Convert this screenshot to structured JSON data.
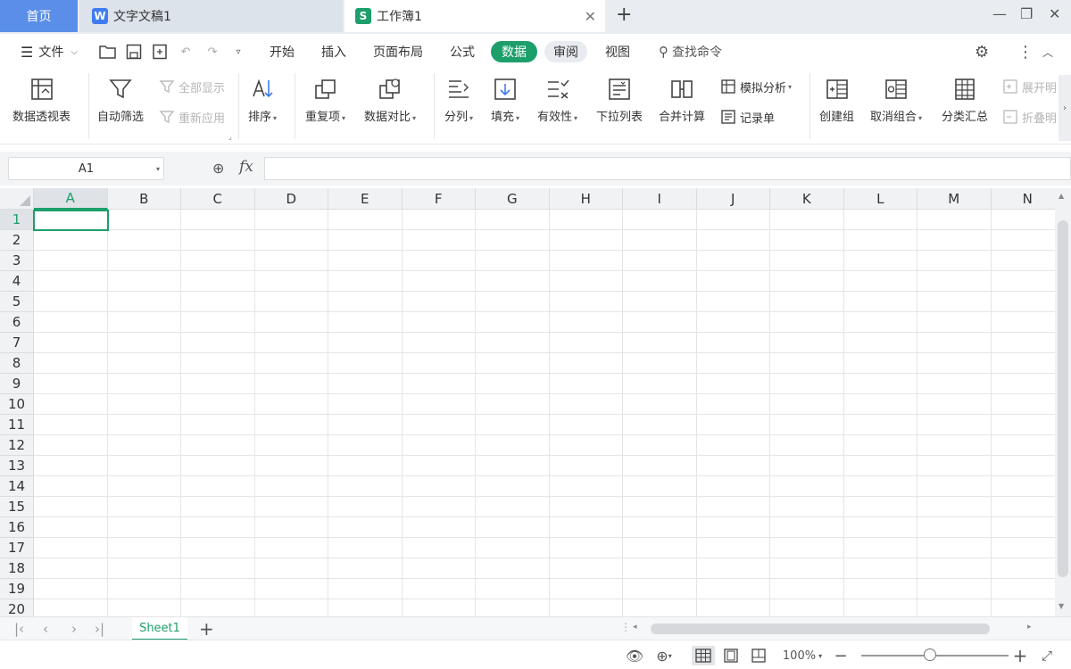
{
  "tabs": {
    "home": "首页",
    "doc": {
      "title": "文字文稿1",
      "icon": "W"
    },
    "book": {
      "title": "工作簿1",
      "icon": "S"
    }
  },
  "menu": {
    "file": "文件",
    "items": [
      "开始",
      "插入",
      "页面布局",
      "公式",
      "数据",
      "审阅",
      "视图"
    ],
    "active": "数据",
    "search_placeholder": "查找命令"
  },
  "ribbon": {
    "pivot": "数据透视表",
    "autofilter": "自动筛选",
    "show_all": "全部显示",
    "reapply": "重新应用",
    "sort": "排序",
    "duplicates": "重复项",
    "compare": "数据对比",
    "split": "分列",
    "fill": "填充",
    "validity": "有效性",
    "dropdown": "下拉列表",
    "consolidate": "合并计算",
    "whatif": "模拟分析",
    "record": "记录单",
    "group": "创建组",
    "ungroup": "取消组合",
    "subtotal": "分类汇总",
    "expand": "展开明",
    "collapse": "折叠明"
  },
  "formula": {
    "cell_ref": "A1",
    "fx": "fx",
    "value": ""
  },
  "grid": {
    "columns": [
      "A",
      "B",
      "C",
      "D",
      "E",
      "F",
      "G",
      "H",
      "I",
      "J",
      "K",
      "L",
      "M",
      "N"
    ],
    "rows": [
      "1",
      "2",
      "3",
      "4",
      "5",
      "6",
      "7",
      "8",
      "9",
      "10",
      "11",
      "12",
      "13",
      "14",
      "15",
      "16",
      "17",
      "18",
      "19",
      "20"
    ],
    "selected_col": "A",
    "selected_row": "1"
  },
  "sheets": {
    "tabs": [
      "Sheet1"
    ],
    "active": "Sheet1"
  },
  "status": {
    "zoom": "100%"
  },
  "colors": {
    "accent": "#1d9f6b",
    "home_tab": "#5b8ee8",
    "doc_icon": "#3f7cf0"
  }
}
